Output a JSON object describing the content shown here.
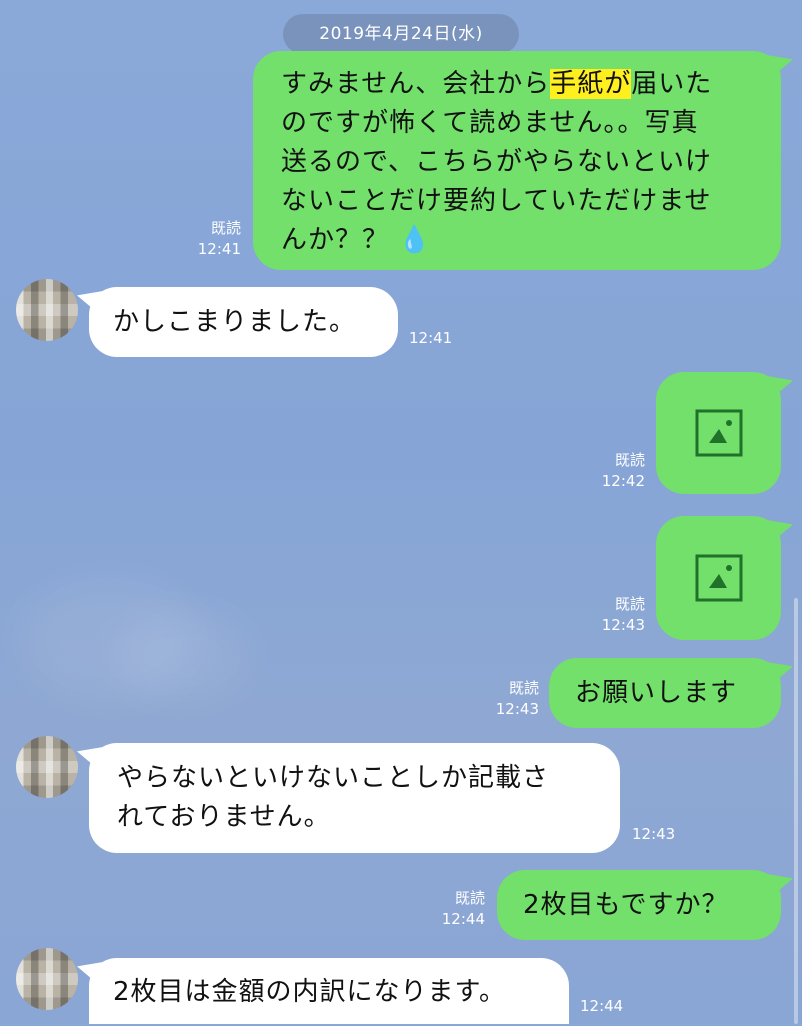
{
  "chat": {
    "date_separator": "2019年4月24日(水)",
    "messages": [
      {
        "side": "outgoing",
        "type": "text",
        "lines": [
          [
            "すみません、会社から",
            "手紙が",
            "届いた"
          ],
          [
            "のですが怖くて読めません。。写真"
          ],
          [
            "送るので、こちらがやらないといけ"
          ],
          [
            "ないことだけ要約していただけませ"
          ],
          [
            "んか？？",
            "💧"
          ]
        ],
        "highlight_color": "#ffef1f",
        "read_label": "既読",
        "time": "12:41"
      },
      {
        "side": "incoming",
        "type": "text",
        "text": "かしこまりました。",
        "time": "12:41"
      },
      {
        "side": "outgoing",
        "type": "image",
        "icon": "image-icon",
        "read_label": "既読",
        "time": "12:42"
      },
      {
        "side": "outgoing",
        "type": "image",
        "icon": "image-icon",
        "read_label": "既読",
        "time": "12:43"
      },
      {
        "side": "outgoing",
        "type": "text",
        "text": "お願いします",
        "read_label": "既読",
        "time": "12:43"
      },
      {
        "side": "incoming",
        "type": "text",
        "lines": [
          "やらないといけないことしか記載さ",
          "れておりません。"
        ],
        "time": "12:43"
      },
      {
        "side": "outgoing",
        "type": "text",
        "text": "2枚目もですか？",
        "read_label": "既読",
        "time": "12:44"
      },
      {
        "side": "incoming",
        "type": "text",
        "text": "2枚目は金額の内訳になります。",
        "time": "12:44"
      }
    ]
  },
  "colors": {
    "outgoing_bubble": "#72e06a",
    "incoming_bubble": "#ffffff",
    "background": "#89a7d6"
  }
}
